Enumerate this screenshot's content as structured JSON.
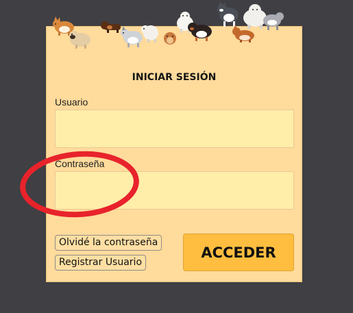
{
  "login": {
    "title": "INICIAR SESIÓN",
    "username_label": "Usuario",
    "username_value": "",
    "password_label": "Contraseña",
    "password_value": "",
    "forgot_label": "Olvidé la contraseña",
    "register_label": "Registrar Usuario",
    "submit_label": "ACCEDER"
  },
  "colors": {
    "background": "#3f3f44",
    "panel": "#ffdb9c",
    "input": "#ffeea9",
    "submit": "#ffbe3f",
    "annotation": "#e8232b"
  },
  "decoration": {
    "banner": "pixel-art-dogs-banner"
  }
}
